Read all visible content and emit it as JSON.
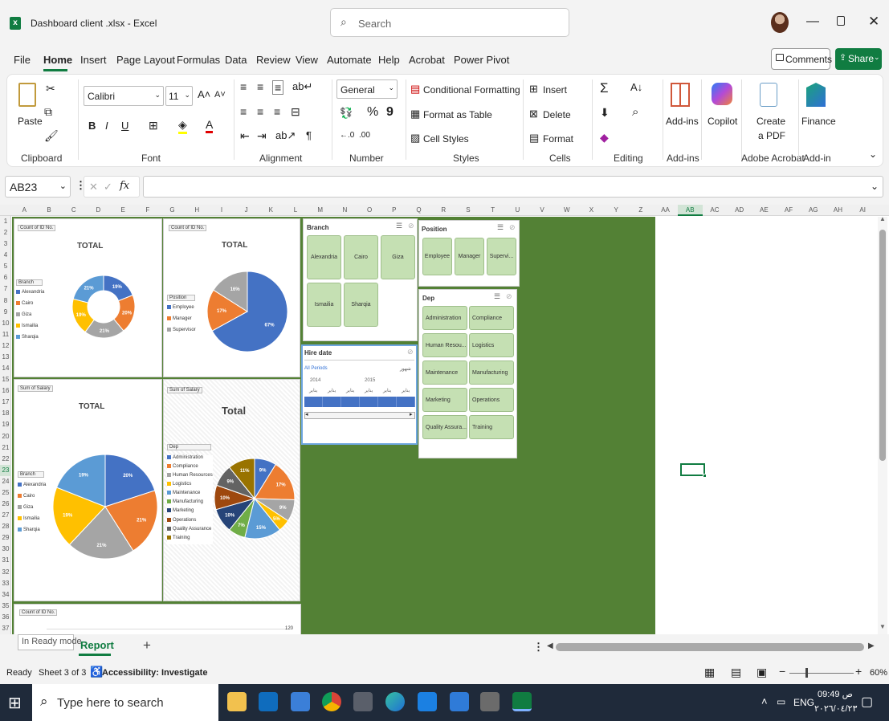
{
  "app": {
    "title": "Dashboard client .xlsx  -  Excel",
    "search_placeholder": "Search"
  },
  "menu": [
    "File",
    "Home",
    "Insert",
    "Page Layout",
    "Formulas",
    "Data",
    "Review",
    "View",
    "Automate",
    "Help",
    "Acrobat",
    "Power Pivot"
  ],
  "top_buttons": {
    "comments": "Comments",
    "share": "Share"
  },
  "ribbon": {
    "clipboard": {
      "paste": "Paste",
      "label": "Clipboard"
    },
    "font": {
      "name": "Calibri",
      "size": "11",
      "label": "Font",
      "bold": "B",
      "italic": "I",
      "underline": "U"
    },
    "alignment": {
      "label": "Alignment"
    },
    "number": {
      "format": "General",
      "label": "Number",
      "percent": "%",
      "comma": "9"
    },
    "styles": {
      "conditional": "Conditional Formatting",
      "format_table": "Format as Table",
      "cell_styles": "Cell Styles",
      "label": "Styles"
    },
    "cells": {
      "insert": "Insert",
      "delete": "Delete",
      "format": "Format",
      "label": "Cells"
    },
    "editing": {
      "label": "Editing"
    },
    "addins": {
      "button": "Add-ins",
      "label": "Add-ins"
    },
    "copilot": {
      "button": "Copilot"
    },
    "acrobat": {
      "line1": "Create",
      "line2": "a PDF",
      "label": "Adobe Acrobat"
    },
    "finance": {
      "button": "Finance",
      "label": "Add-in"
    }
  },
  "formula_bar": {
    "name_box": "AB23",
    "value": ""
  },
  "columns": [
    "A",
    "B",
    "C",
    "D",
    "E",
    "F",
    "G",
    "H",
    "I",
    "J",
    "K",
    "L",
    "M",
    "N",
    "O",
    "P",
    "Q",
    "R",
    "S",
    "T",
    "U",
    "V",
    "W",
    "X",
    "Y",
    "Z",
    "AA",
    "AB",
    "AC",
    "AD",
    "AE",
    "AF",
    "AG",
    "AH",
    "AI"
  ],
  "rows": [
    "1",
    "2",
    "3",
    "4",
    "5",
    "6",
    "7",
    "8",
    "9",
    "10",
    "11",
    "12",
    "13",
    "14",
    "15",
    "16",
    "17",
    "18",
    "19",
    "20",
    "21",
    "22",
    "23",
    "24",
    "25",
    "26",
    "27",
    "28",
    "29",
    "30",
    "31",
    "32",
    "33",
    "34",
    "35",
    "36",
    "37"
  ],
  "colors": {
    "dashboard_bg": "#538135",
    "blue": "#4472c4",
    "orange": "#ed7d31",
    "gray": "#a5a5a5",
    "yellow": "#ffc000",
    "lightblue": "#5b9bd5",
    "green": "#70ad47",
    "navy": "#264478",
    "brown": "#9e480e",
    "darkgray": "#636363",
    "olive": "#997300",
    "slicer": "#c5e0b3"
  },
  "charts": {
    "chart1": {
      "field": "Count of ID No.",
      "title": "TOTAL",
      "filter": "Branch",
      "legend": [
        "Alexandria",
        "Cairo",
        "Giza",
        "Ismailia",
        "Sharqia"
      ]
    },
    "chart2": {
      "field": "Count of ID No.",
      "title": "TOTAL",
      "filter": "Position",
      "legend": [
        "Employee",
        "Manager",
        "Supervisor"
      ]
    },
    "chart3": {
      "field": "Sum of Salary",
      "title": "TOTAL",
      "filter": "Branch",
      "legend": [
        "Alexandria",
        "Cairo",
        "Giza",
        "Ismailia",
        "Sharqia"
      ]
    },
    "chart4": {
      "field": "Sum of Salary",
      "title": "Total",
      "filter": "Dep",
      "legend": [
        "Administration",
        "Compliance",
        "Human Resources",
        "Logistics",
        "Maintenance",
        "Manufacturing",
        "Marketing",
        "Operations",
        "Quality Assurance",
        "Training"
      ]
    },
    "chart5": {
      "field": "Count of ID No.",
      "axis_value": "120"
    }
  },
  "chart_data": [
    {
      "type": "pie",
      "title": "TOTAL",
      "categories": [
        "Alexandria",
        "Cairo",
        "Giza",
        "Ismailia",
        "Sharqia"
      ],
      "values": [
        19,
        20,
        21,
        19,
        21
      ],
      "labels": [
        "19%",
        "20%",
        "21%",
        "19%",
        "21%"
      ]
    },
    {
      "type": "pie",
      "title": "TOTAL",
      "categories": [
        "Employee",
        "Manager",
        "Supervisor"
      ],
      "values": [
        67,
        17,
        16
      ],
      "labels": [
        "67%",
        "17%",
        "16%"
      ]
    },
    {
      "type": "pie",
      "title": "TOTAL",
      "categories": [
        "Alexandria",
        "Cairo",
        "Giza",
        "Ismailia",
        "Sharqia"
      ],
      "values": [
        20,
        21,
        21,
        19,
        19
      ],
      "labels": [
        "20%",
        "21%",
        "21%",
        "19%",
        "19%"
      ]
    },
    {
      "type": "pie",
      "title": "Total",
      "categories": [
        "Administration",
        "Compliance",
        "Human Resources",
        "Logistics",
        "Maintenance",
        "Manufacturing",
        "Marketing",
        "Operations",
        "Quality Assurance",
        "Training"
      ],
      "values": [
        9,
        17,
        9,
        5,
        15,
        7,
        10,
        10,
        9,
        11
      ],
      "labels": [
        "9%",
        "17%",
        "9%",
        "5%",
        "15%",
        "7%",
        "10%",
        "10%",
        "9%",
        "11%"
      ]
    }
  ],
  "slicers": {
    "branch": {
      "title": "Branch",
      "items": [
        "Alexandria",
        "Cairo",
        "Giza",
        "Ismailia",
        "Sharqia"
      ]
    },
    "position": {
      "title": "Position",
      "items": [
        "Employee",
        "Manager",
        "Supervi..."
      ]
    },
    "dep": {
      "title": "Dep",
      "items": [
        "Administration",
        "Compliance",
        "Human Resou...",
        "Logistics",
        "Maintenance",
        "Manufacturing",
        "Marketing",
        "Operations",
        "Quality Assura...",
        "Training"
      ]
    },
    "hire_date": {
      "title": "Hire date",
      "periods": "All Periods",
      "unit": "شهور",
      "years": [
        "2014",
        "2015"
      ],
      "months": [
        "يناير",
        "يناير",
        "يناير",
        "يناير",
        "يناير",
        "يناير"
      ]
    }
  },
  "sheet": {
    "mode": "In Ready mode",
    "tab": "Report",
    "add": "+"
  },
  "status": {
    "ready": "Ready",
    "sheet_info": "Sheet 3 of 3",
    "accessibility": "Accessibility: Investigate",
    "zoom": "60%"
  },
  "taskbar": {
    "search": "Type here to search",
    "lang": "ENG",
    "time": "09:49 ص",
    "date": "٢٠٢٦/٠٤/٢٣"
  }
}
